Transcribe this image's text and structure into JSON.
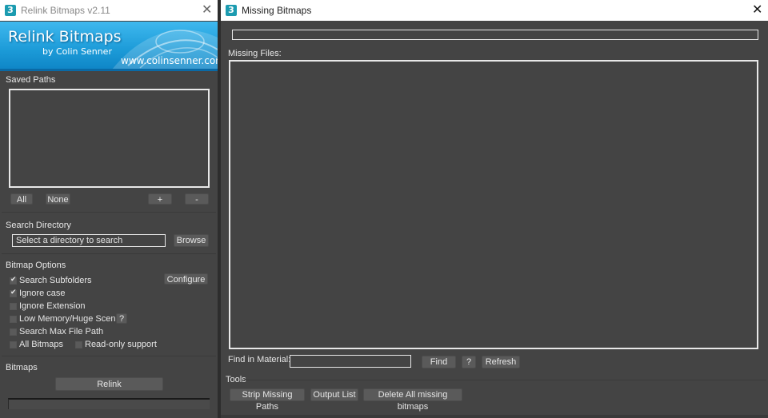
{
  "left_window": {
    "title": "Relink Bitmaps v2.11",
    "banner": {
      "title": "Relink Bitmaps",
      "byline": "by Colin Senner",
      "url": "www.colinsenner.com"
    },
    "saved_paths": {
      "header": "Saved Paths",
      "buttons": {
        "all": "All",
        "none": "None",
        "add": "+",
        "remove": "-"
      }
    },
    "search_directory": {
      "header": "Search Directory",
      "input_value": "Select a directory to search",
      "browse": "Browse"
    },
    "bitmap_options": {
      "header": "Bitmap Options",
      "configure": "Configure",
      "help": "?",
      "options": [
        {
          "label": "Search Subfolders",
          "checked": true
        },
        {
          "label": "Ignore case",
          "checked": true
        },
        {
          "label": "Ignore Extension",
          "checked": false
        },
        {
          "label": "Low Memory/Huge Scene",
          "checked": false
        },
        {
          "label": "Search Max File Path",
          "checked": false
        },
        {
          "label": "All Bitmaps",
          "checked": false
        },
        {
          "label": "Read-only support",
          "checked": false
        }
      ]
    },
    "bitmaps": {
      "header": "Bitmaps",
      "relink": "Relink"
    }
  },
  "right_window": {
    "title": "Missing Bitmaps",
    "missing_files_label": "Missing Files:",
    "find_in_material_label": "Find in Material:",
    "find": "Find",
    "help": "?",
    "refresh": "Refresh",
    "tools": {
      "header": "Tools",
      "strip_missing_paths": "Strip Missing Paths",
      "output_list": "Output List",
      "delete_all": "Delete All missing bitmaps"
    }
  },
  "colors": {
    "panel_bg": "#444444",
    "titlebar_bg": "#ffffff",
    "banner_bg": "#1c9bd8",
    "app_icon": "#1b9bb0"
  },
  "icons": {
    "app": "3ds-max-icon",
    "close": "close-icon"
  }
}
